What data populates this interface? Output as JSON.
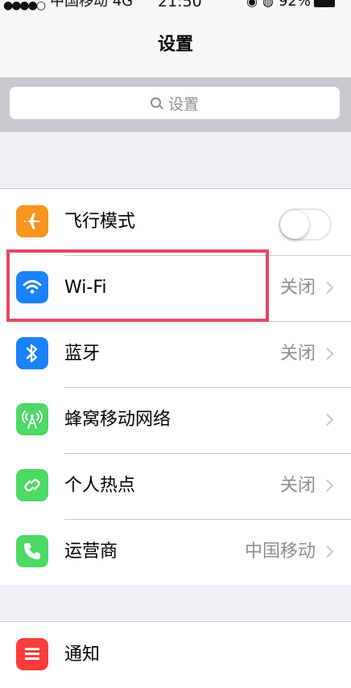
{
  "status_bar": {
    "signal": "●●●●○",
    "carrier": "中国移动",
    "network": "4G",
    "time": "21:50",
    "battery_percent": "92%"
  },
  "nav": {
    "title": "设置"
  },
  "search": {
    "placeholder": "设置"
  },
  "group1": {
    "items": [
      {
        "label": "飞行模式",
        "icon": "airplane-icon",
        "icon_color": "#f7951f",
        "toggle_on": false
      },
      {
        "label": "Wi-Fi",
        "icon": "wifi-icon",
        "icon_color": "#1a82fb",
        "value": "关闭"
      },
      {
        "label": "蓝牙",
        "icon": "bluetooth-icon",
        "icon_color": "#1a82fb",
        "value": "关闭"
      },
      {
        "label": "蜂窝移动网络",
        "icon": "cellular-icon",
        "icon_color": "#4cd964",
        "value": ""
      },
      {
        "label": "个人热点",
        "icon": "hotspot-icon",
        "icon_color": "#4cd964",
        "value": "关闭"
      },
      {
        "label": "运营商",
        "icon": "phone-icon",
        "icon_color": "#4cd964",
        "value": "中国移动"
      }
    ]
  },
  "group2": {
    "items": [
      {
        "label": "通知",
        "icon": "notifications-icon",
        "icon_color": "#fc3d39"
      }
    ]
  },
  "highlight_color": "#e24a62"
}
